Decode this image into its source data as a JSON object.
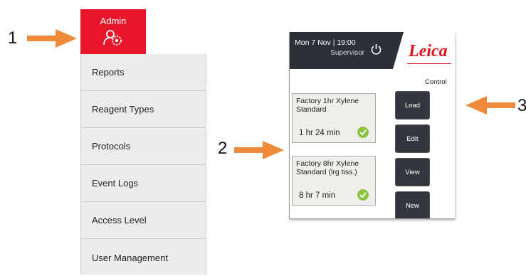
{
  "callouts": [
    "1",
    "2",
    "3"
  ],
  "admin": {
    "label": "Admin",
    "icon": "admin-gear-icon"
  },
  "menu": {
    "items": [
      {
        "label": "Reports"
      },
      {
        "label": "Reagent Types"
      },
      {
        "label": "Protocols"
      },
      {
        "label": "Event Logs"
      },
      {
        "label": "Access Level"
      },
      {
        "label": "User Management"
      }
    ]
  },
  "screen": {
    "datetime": "Mon 7 Nov | 19:00",
    "role": "Supervisor",
    "logo": "Leica",
    "control_label": "Control",
    "protocols": [
      {
        "name": "Factory 1hr Xylene Standard",
        "duration": "1 hr 24 min",
        "status_icon": "check-icon"
      },
      {
        "name": "Factory 8hr Xylene Standard (lrg tiss.)",
        "duration": "8 hr 7 min",
        "status_icon": "check-icon"
      }
    ],
    "buttons": [
      {
        "label": "Load"
      },
      {
        "label": "Edit"
      },
      {
        "label": "View"
      },
      {
        "label": "New"
      }
    ]
  },
  "colors": {
    "admin_red": "#e8162b",
    "arrow_orange": "#f08a3b",
    "status_bar": "#2e3039",
    "check_green": "#8bc53f",
    "logo_red": "#e1111e"
  }
}
